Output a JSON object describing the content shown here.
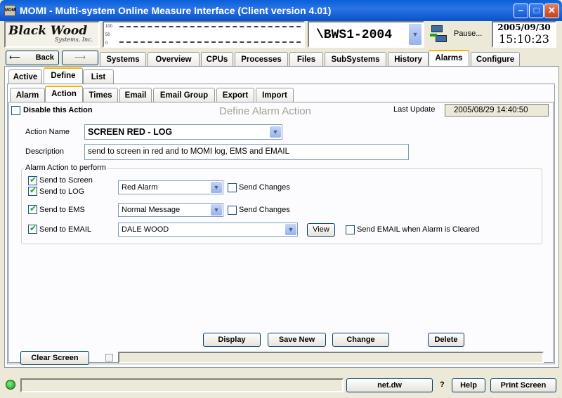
{
  "window": {
    "title": "MOMI - Multi-system Online Measure Interface (Client version 4.01)",
    "icon_label": "MOMI",
    "minimize": "–",
    "maximize": "□",
    "close": "✕"
  },
  "header": {
    "logo_line1": "Black Wood",
    "logo_line2": "Systems, Inc.",
    "graph_ticks": [
      "100",
      "50",
      "0"
    ],
    "system": "\\BWS1-2004",
    "pause_label": "Pause...",
    "date": "2005/09/30",
    "time": "15:10:23"
  },
  "nav": {
    "back": "Back",
    "forward": "",
    "tabs": [
      "Systems",
      "Overview",
      "CPUs",
      "Processes",
      "Files",
      "SubSystems",
      "History",
      "Alarms",
      "Configure"
    ]
  },
  "alarm_tabs": [
    "Active",
    "Define",
    "List"
  ],
  "define_tabs": [
    "Alarm",
    "Action",
    "Times",
    "Email",
    "Email Group",
    "Export",
    "Import"
  ],
  "form": {
    "disable_label": "Disable this Action",
    "heading": "Define Alarm Action",
    "last_update_label": "Last Update",
    "last_update_value": "2005/08/29 14:40:50",
    "action_name_label": "Action Name",
    "action_name_value": "SCREEN RED - LOG",
    "description_label": "Description",
    "description_value": "send to screen in red and to MOMI log, EMS and EMAIL",
    "group_label": "Alarm Action to perform",
    "send_screen": "Send to Screen",
    "send_log": "Send to LOG",
    "log_select": "Red Alarm",
    "send_changes": "Send Changes",
    "send_ems": "Send to EMS",
    "ems_select": "Normal Message",
    "send_email": "Send to EMAIL",
    "email_select": "DALE WOOD",
    "view": "View",
    "email_cleared": "Send EMAIL when Alarm is Cleared"
  },
  "actions": {
    "display": "Display",
    "save_new": "Save New",
    "change": "Change",
    "delete": "Delete",
    "clear_screen": "Clear Screen"
  },
  "status": {
    "server": "net.dw",
    "question": "?",
    "help": "Help",
    "print": "Print Screen"
  }
}
